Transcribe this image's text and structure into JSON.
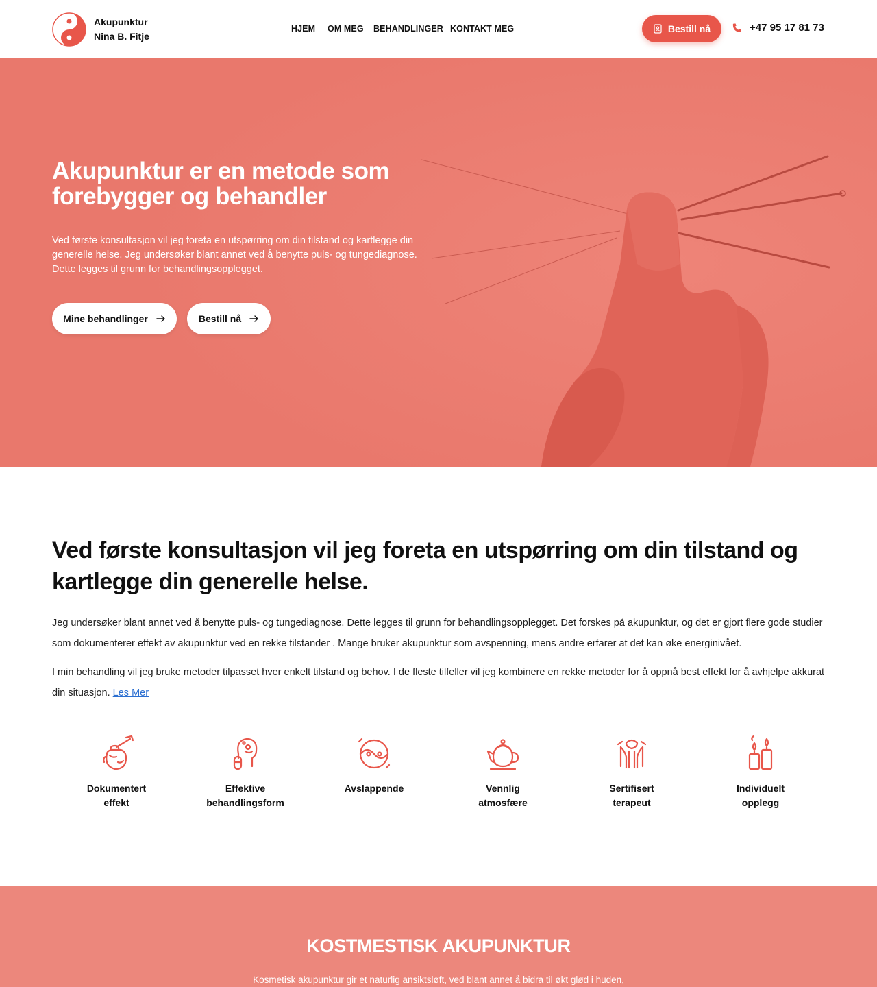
{
  "header": {
    "brand_line1": "Akupunktur",
    "brand_line2": "Nina B. Fitje",
    "nav": [
      "HJEM",
      "OM MEG",
      "BEHANDLINGER",
      "KONTAKT MEG"
    ],
    "cta_label": "Bestill nå",
    "phone": "+47 95 17 81 73"
  },
  "hero": {
    "title": "Akupunktur er en metode som forebygger og behandler",
    "text": "Ved første konsultasjon vil jeg foreta en utspørring om din tilstand og kartlegge din generelle helse. Jeg undersøker blant annet ved å benytte puls- og tungediagnose. Dette legges til grunn for behandlingsopplegget.",
    "button_treatments": "Mine behandlinger",
    "button_book": "Bestill nå"
  },
  "intro": {
    "heading": "Ved første konsultasjon vil jeg foreta en utspørring om din tilstand og kartlegge din generelle helse.",
    "para1": "Jeg undersøker blant annet ved å benytte puls- og tungediagnose. Dette legges til grunn for behandlingsopplegget. Det forskes på akupunktur, og det er gjort flere gode studier som dokumenterer effekt av akupunktur ved en rekke tilstander . Mange bruker akupunktur som avspenning, mens andre erfarer at det kan øke energinivået.",
    "para2": "I min behandling vil jeg bruke metoder tilpasset hver enkelt tilstand og behov. I de fleste tilfeller vil jeg kombinere en rekke metoder for å oppnå best effekt for å avhjelpe akkurat din situasjon.",
    "read_more": "Les Mer"
  },
  "features": [
    {
      "line1": "Dokumentert",
      "line2": "effekt",
      "icon": "honey-pot-icon"
    },
    {
      "line1": "Effektive",
      "line2": "behandlingsform",
      "icon": "head-flask-icon"
    },
    {
      "line1": "Avslappende",
      "line2": "",
      "icon": "yin-yang-icon"
    },
    {
      "line1": "Vennlig",
      "line2": "atmosfære",
      "icon": "teapot-icon"
    },
    {
      "line1": "Sertifisert",
      "line2": "terapeut",
      "icon": "massage-therapist-icon"
    },
    {
      "line1": "Individuelt",
      "line2": "opplegg",
      "icon": "candles-icon"
    }
  ],
  "band": {
    "title": "KOSTMESTISK AKUPUNKTUR",
    "text": "Kosmetisk akupunktur gir et naturlig ansiktsløft, ved blant annet å bidra til økt glød i huden,"
  },
  "colors": {
    "accent": "#e8564a",
    "hero_bg": "#e9786c",
    "band_bg": "#ec877c",
    "link": "#2b6fd1"
  }
}
